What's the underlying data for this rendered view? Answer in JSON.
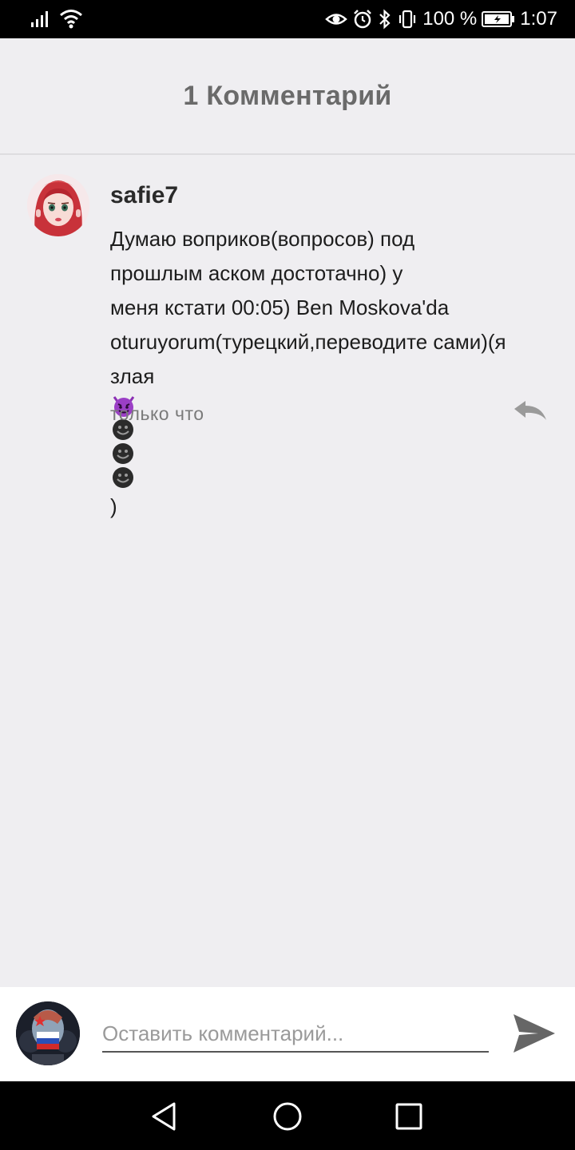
{
  "status_bar": {
    "battery_percent": "100 %",
    "time": "1:07",
    "icons": [
      "signal-icon",
      "wifi-icon",
      "eye-icon",
      "alarm-icon",
      "bluetooth-icon",
      "vibrate-icon",
      "battery-icon"
    ]
  },
  "header": {
    "title": "1 Комментарий"
  },
  "comment": {
    "username": "safie7",
    "text_lines": [
      "Думаю воприков(вопросов) под",
      "прошлым аском достотачно) у",
      "меня кстати 00:05) Ben Moskova'da",
      "oturuyorum(турецкий,переводите сами)(я",
      "злая"
    ],
    "text_end": ")",
    "emojis": [
      "devil-emoji",
      "smiley-emoji",
      "smiley-emoji",
      "smiley-emoji"
    ],
    "time": "только что"
  },
  "composer": {
    "placeholder": "Оставить комментарий..."
  },
  "colors": {
    "background": "#efeef1",
    "header_title": "#6a6a6a",
    "composer_background": "#ffffff",
    "send_icon": "#666666"
  }
}
